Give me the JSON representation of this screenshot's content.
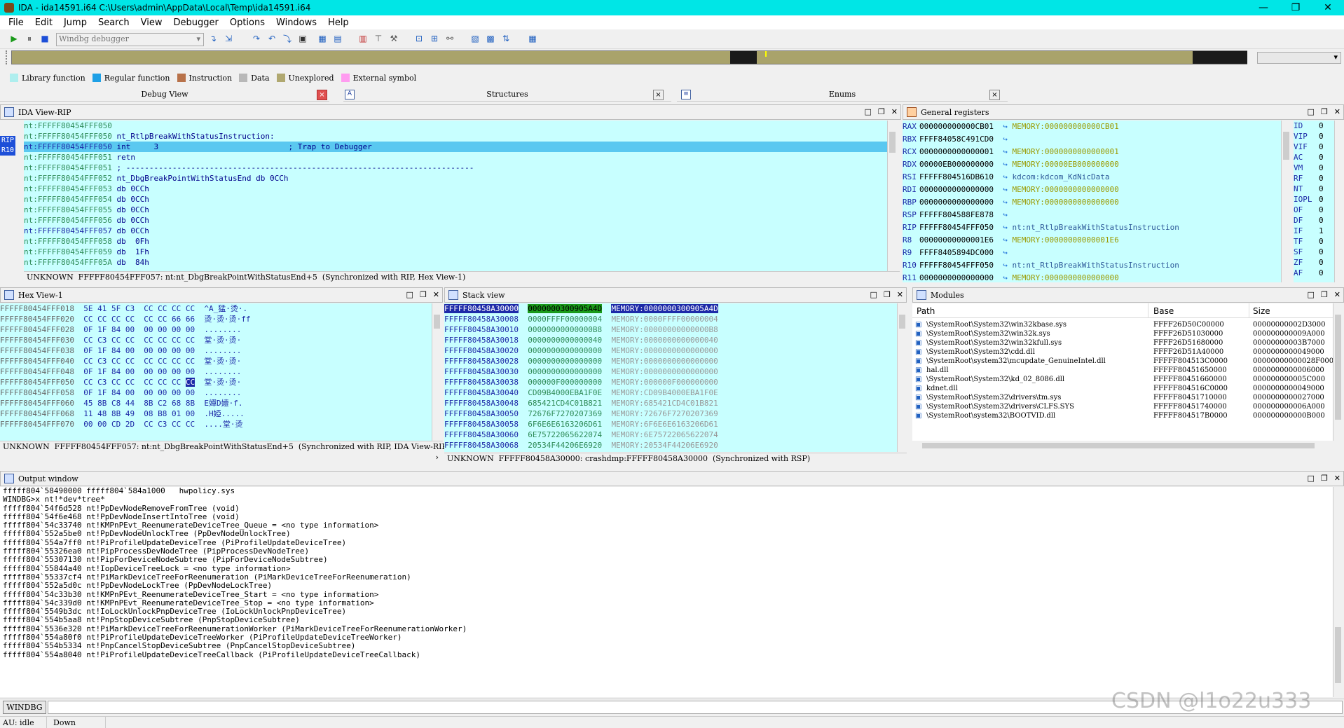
{
  "window": {
    "title": "IDA - ida14591.i64 C:\\Users\\admin\\AppData\\Local\\Temp\\ida14591.i64",
    "minimize": "—",
    "restore": "❐",
    "close": "✕"
  },
  "menu": [
    "File",
    "Edit",
    "Jump",
    "Search",
    "View",
    "Debugger",
    "Options",
    "Windows",
    "Help"
  ],
  "toolbar": {
    "debugger_select": "Windbg debugger"
  },
  "legend": [
    {
      "label": "Library function",
      "color": "#aeeeee"
    },
    {
      "label": "Regular function",
      "color": "#1ea0e6"
    },
    {
      "label": "Instruction",
      "color": "#b8724a"
    },
    {
      "label": "Data",
      "color": "#b8b8b8"
    },
    {
      "label": "Unexplored",
      "color": "#b0a870"
    },
    {
      "label": "External symbol",
      "color": "#ff9cf0"
    }
  ],
  "tabs": [
    {
      "label": "Debug View"
    },
    {
      "label": "Structures"
    },
    {
      "label": "Enums"
    }
  ],
  "ida_view": {
    "title": "IDA View-RIP",
    "lines": [
      {
        "addr": "nt:FFFFF80454FFF050",
        "text": ""
      },
      {
        "addr": "nt:FFFFF80454FFF050",
        "text": " nt_RtlpBreakWithStatusInstruction:"
      },
      {
        "addr": "nt:FFFFF80454FFF050",
        "text": " int     3                            ; Trap to Debugger"
      },
      {
        "addr": "nt:FFFFF80454FFF051",
        "text": " retn"
      },
      {
        "addr": "nt:FFFFF80454FFF051",
        "text": " ; ---------------------------------------------------------------------------"
      },
      {
        "addr": "nt:FFFFF80454FFF052",
        "text": " nt_DbgBreakPointWithStatusEnd db 0CCh"
      },
      {
        "addr": "nt:FFFFF80454FFF053",
        "text": " db 0CCh"
      },
      {
        "addr": "nt:FFFFF80454FFF054",
        "text": " db 0CCh"
      },
      {
        "addr": "nt:FFFFF80454FFF055",
        "text": " db 0CCh"
      },
      {
        "addr": "nt:FFFFF80454FFF056",
        "text": " db 0CCh"
      },
      {
        "addr": "nt:FFFFF80454FFF057",
        "text": " db 0CCh"
      },
      {
        "addr": "nt:FFFFF80454FFF058",
        "text": " db  0Fh"
      },
      {
        "addr": "nt:FFFFF80454FFF059",
        "text": " db  1Fh"
      },
      {
        "addr": "nt:FFFFF80454FFF05A",
        "text": " db  84h"
      }
    ],
    "labels": [
      "RIP",
      "R10"
    ],
    "status": "UNKNOWN  FFFFF80454FFF057: nt:nt_DbgBreakPointWithStatusEnd+5  (Synchronized with RIP, Hex View-1)"
  },
  "registers": {
    "title": "General registers",
    "rows": [
      {
        "name": "RAX",
        "value": "000000000000CB01",
        "info": "MEMORY:000000000000CB01"
      },
      {
        "name": "RBX",
        "value": "FFFF84058C491CD0",
        "info": ""
      },
      {
        "name": "RCX",
        "value": "0000000000000001",
        "info": "MEMORY:0000000000000001"
      },
      {
        "name": "RDX",
        "value": "00000EB000000000",
        "info": "MEMORY:00000EB000000000"
      },
      {
        "name": "RSI",
        "value": "FFFFF804516DB610",
        "info": "kdcom:kdcom_KdNicData"
      },
      {
        "name": "RDI",
        "value": "0000000000000000",
        "info": "MEMORY:0000000000000000"
      },
      {
        "name": "RBP",
        "value": "0000000000000000",
        "info": "MEMORY:0000000000000000"
      },
      {
        "name": "RSP",
        "value": "FFFFF804588FE878",
        "info": ""
      },
      {
        "name": "RIP",
        "value": "FFFFF80454FFF050",
        "info": "nt:nt_RtlpBreakWithStatusInstruction"
      },
      {
        "name": "R8",
        "value": "00000000000001E6",
        "info": "MEMORY:00000000000001E6"
      },
      {
        "name": "R9",
        "value": "FFFF8405894DC000",
        "info": ""
      },
      {
        "name": "R10",
        "value": "FFFFF80454FFF050",
        "info": "nt:nt_RtlpBreakWithStatusInstruction"
      },
      {
        "name": "R11",
        "value": "0000000000000000",
        "info": "MEMORY:0000000000000000"
      }
    ],
    "flags": [
      {
        "name": "ID",
        "value": "0"
      },
      {
        "name": "VIP",
        "value": "0"
      },
      {
        "name": "VIF",
        "value": "0"
      },
      {
        "name": "AC",
        "value": "0"
      },
      {
        "name": "VM",
        "value": "0"
      },
      {
        "name": "RF",
        "value": "0"
      },
      {
        "name": "NT",
        "value": "0"
      },
      {
        "name": "IOPL",
        "value": "0"
      },
      {
        "name": "OF",
        "value": "0"
      },
      {
        "name": "DF",
        "value": "0"
      },
      {
        "name": "IF",
        "value": "1"
      },
      {
        "name": "TF",
        "value": "0"
      },
      {
        "name": "SF",
        "value": "0"
      },
      {
        "name": "ZF",
        "value": "0"
      },
      {
        "name": "AF",
        "value": "0"
      }
    ]
  },
  "hex_view": {
    "title": "Hex View-1",
    "rows": [
      {
        "addr": "FFFFF80454FFF018",
        "bytes": "5E 41 5F C3  CC CC CC CC",
        "ascii": "^A_猛·烫·."
      },
      {
        "addr": "FFFFF80454FFF020",
        "bytes": "CC CC CC CC  CC CC 66 66",
        "ascii": "烫·烫·烫·ff"
      },
      {
        "addr": "FFFFF80454FFF028",
        "bytes": "0F 1F 84 00  00 00 00 00",
        "ascii": "........"
      },
      {
        "addr": "FFFFF80454FFF030",
        "bytes": "CC C3 CC CC  CC CC CC CC",
        "ascii": "堂·烫·烫·"
      },
      {
        "addr": "FFFFF80454FFF038",
        "bytes": "0F 1F 84 00  00 00 00 00",
        "ascii": "........"
      },
      {
        "addr": "FFFFF80454FFF040",
        "bytes": "CC C3 CC CC  CC CC CC CC",
        "ascii": "堂·烫·烫·"
      },
      {
        "addr": "FFFFF80454FFF048",
        "bytes": "0F 1F 84 00  00 00 00 00",
        "ascii": "........"
      },
      {
        "addr": "FFFFF80454FFF050",
        "bytes": "CC C3 CC CC  CC CC CC CC",
        "ascii": "堂·烫·烫·"
      },
      {
        "addr": "FFFFF80454FFF058",
        "bytes": "0F 1F 84 00  00 00 00 00",
        "ascii": "........"
      },
      {
        "addr": "FFFFF80454FFF060",
        "bytes": "45 8B C8 44  8B C2 68 8B",
        "ascii": "E嬋D嬄·f."
      },
      {
        "addr": "FFFFF80454FFF068",
        "bytes": "11 48 8B 49  08 B8 01 00",
        "ascii": ".H婭....."
      },
      {
        "addr": "FFFFF80454FFF070",
        "bytes": "00 00 CD 2D  CC C3 CC CC",
        "ascii": "....堂·烫"
      }
    ],
    "status": "UNKNOWN  FFFFF80454FFF057: nt:nt_DbgBreakPointWithStatusEnd+5  (Synchronized with RIP, IDA View-RIP)"
  },
  "stack_view": {
    "title": "Stack view",
    "rows": [
      {
        "addr": "FFFFF80458A30000",
        "value": "0000000300905A4D",
        "info": "MEMORY:0000000300905A4D"
      },
      {
        "addr": "FFFFF80458A30008",
        "value": "0000FFFF00000004",
        "info": "MEMORY:0000FFFF00000004"
      },
      {
        "addr": "FFFFF80458A30010",
        "value": "00000000000000B8",
        "info": "MEMORY:00000000000000B8"
      },
      {
        "addr": "FFFFF80458A30018",
        "value": "0000000000000040",
        "info": "MEMORY:0000000000000040"
      },
      {
        "addr": "FFFFF80458A30020",
        "value": "0000000000000000",
        "info": "MEMORY:0000000000000000"
      },
      {
        "addr": "FFFFF80458A30028",
        "value": "0000000000000000",
        "info": "MEMORY:0000000000000000"
      },
      {
        "addr": "FFFFF80458A30030",
        "value": "0000000000000000",
        "info": "MEMORY:0000000000000000"
      },
      {
        "addr": "FFFFF80458A30038",
        "value": "000000F000000000",
        "info": "MEMORY:000000F000000000"
      },
      {
        "addr": "FFFFF80458A30040",
        "value": "CD09B4000EBA1F0E",
        "info": "MEMORY:CD09B4000EBA1F0E"
      },
      {
        "addr": "FFFFF80458A30048",
        "value": "685421CD4C01B821",
        "info": "MEMORY:685421CD4C01B821"
      },
      {
        "addr": "FFFFF80458A30050",
        "value": "72676F7270207369",
        "info": "MEMORY:72676F7270207369"
      },
      {
        "addr": "FFFFF80458A30058",
        "value": "6F6E6E6163206D61",
        "info": "MEMORY:6F6E6E6163206D61"
      },
      {
        "addr": "FFFFF80458A30060",
        "value": "6E75722065622074",
        "info": "MEMORY:6E75722065622074"
      },
      {
        "addr": "FFFFF80458A30068",
        "value": "20534F44206E6920",
        "info": "MEMORY:20534F44206E6920"
      }
    ],
    "status": "UNKNOWN  FFFFF80458A30000: crashdmp:FFFFF80458A30000  (Synchronized with RSP)"
  },
  "modules": {
    "title": "Modules",
    "columns": [
      "Path",
      "Base",
      "Size"
    ],
    "rows": [
      {
        "path": "\\SystemRoot\\System32\\win32kbase.sys",
        "base": "FFFF26D50C00000",
        "size": "00000000002D3000"
      },
      {
        "path": "\\SystemRoot\\System32\\win32k.sys",
        "base": "FFFF26D51030000",
        "size": "000000000009A000"
      },
      {
        "path": "\\SystemRoot\\System32\\win32kfull.sys",
        "base": "FFFF26D51680000",
        "size": "00000000003B7000"
      },
      {
        "path": "\\SystemRoot\\System32\\cdd.dll",
        "base": "FFFF26D51A40000",
        "size": "0000000000049000"
      },
      {
        "path": "\\SystemRoot\\system32\\mcupdate_GenuineIntel.dll",
        "base": "FFFFF804513C0000",
        "size": "00000000000028F000"
      },
      {
        "path": "hal.dll",
        "base": "FFFFF80451650000",
        "size": "0000000000006000"
      },
      {
        "path": "\\SystemRoot\\System32\\kd_02_8086.dll",
        "base": "FFFFF80451660000",
        "size": "000000000005C000"
      },
      {
        "path": "kdnet.dll",
        "base": "FFFFF804516C0000",
        "size": "0000000000049000"
      },
      {
        "path": "\\SystemRoot\\System32\\drivers\\tm.sys",
        "base": "FFFFF80451710000",
        "size": "0000000000027000"
      },
      {
        "path": "\\SystemRoot\\System32\\drivers\\CLFS.SYS",
        "base": "FFFFF80451740000",
        "size": "000000000006A000"
      },
      {
        "path": "\\SystemRoot\\system32\\BOOTVID.dll",
        "base": "FFFFF804517B0000",
        "size": "000000000000B000"
      }
    ]
  },
  "output": {
    "title": "Output window",
    "lines": [
      "fffff804`58490000 fffff804`584a1000   hwpolicy.sys",
      "WINDBG>x nt!*dev*tree*",
      "fffff804`54f6d528 nt!PpDevNodeRemoveFromTree (void)",
      "fffff804`54f6e468 nt!PpDevNodeInsertIntoTree (void)",
      "fffff804`54c33740 nt!KMPnPEvt_ReenumerateDeviceTree_Queue = <no type information>",
      "fffff804`552a5be0 nt!PpDevNodeUnlockTree (PpDevNodeUnlockTree)",
      "fffff804`554a7ff0 nt!PiProfileUpdateDeviceTree (PiProfileUpdateDeviceTree)",
      "fffff804`55326ea0 nt!PipProcessDevNodeTree (PipProcessDevNodeTree)",
      "fffff804`55307130 nt!PipForDeviceNodeSubtree (PipForDeviceNodeSubtree)",
      "fffff804`55844a40 nt!IopDeviceTreeLock = <no type information>",
      "fffff804`55337cf4 nt!PiMarkDeviceTreeForReenumeration (PiMarkDeviceTreeForReenumeration)",
      "fffff804`552a5d0c nt!PpDevNodeLockTree (PpDevNodeLockTree)",
      "fffff804`54c33b30 nt!KMPnPEvt_ReenumerateDeviceTree_Start = <no type information>",
      "fffff804`54c339d0 nt!KMPnPEvt_ReenumerateDeviceTree_Stop = <no type information>",
      "fffff804`5549b3dc nt!IoLockUnlockPnpDeviceTree (IoLockUnlockPnpDeviceTree)",
      "fffff804`554b5aa8 nt!PnpStopDeviceSubtree (PnpStopDeviceSubtree)",
      "fffff804`5536e320 nt!PiMarkDeviceTreeForReenumerationWorker (PiMarkDeviceTreeForReenumerationWorker)",
      "fffff804`554a80f0 nt!PiProfileUpdateDeviceTreeWorker (PiProfileUpdateDeviceTreeWorker)",
      "fffff804`554b5334 nt!PnpCancelStopDeviceSubtree (PnpCancelStopDeviceSubtree)",
      "fffff804`554a8040 nt!PiProfileUpdateDeviceTreeCallback (PiProfileUpdateDeviceTreeCallback)"
    ],
    "command_button": "WINDBG",
    "command_value": ""
  },
  "status_bar": {
    "au": "AU:  idle",
    "direction": "Down"
  },
  "watermark": "CSDN @l1o22u333"
}
